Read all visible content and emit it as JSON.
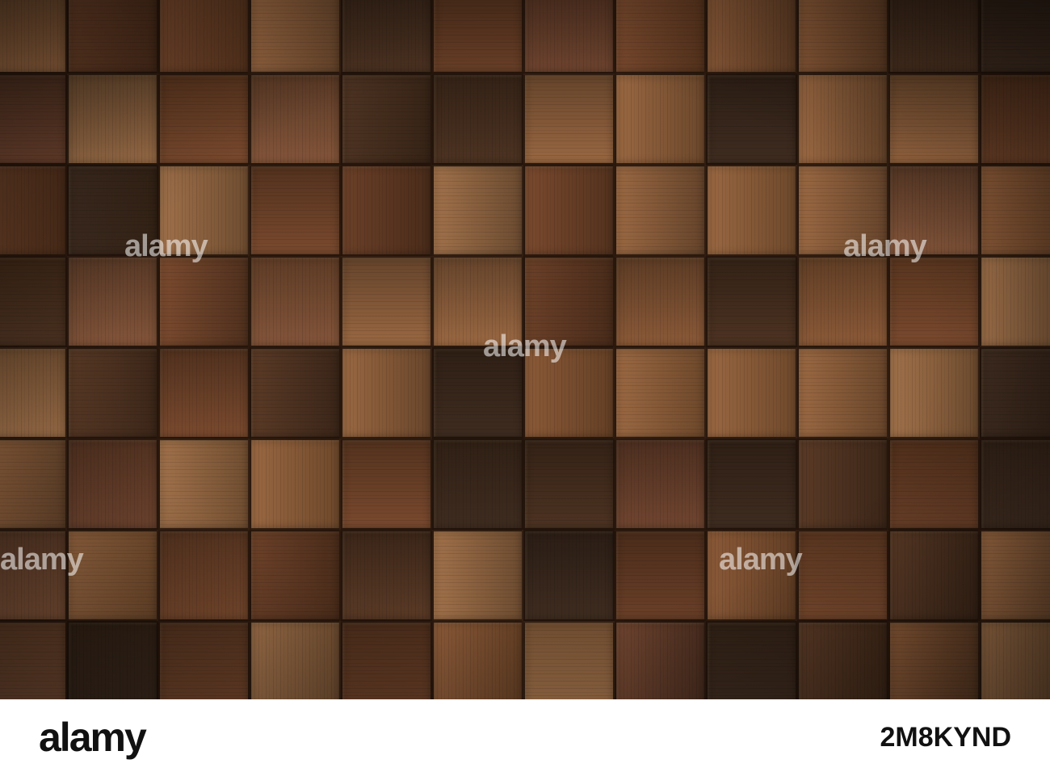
{
  "image": {
    "subject": "wood-tile-mosaic",
    "palette": [
      "#7a4a2e",
      "#8b5a38",
      "#6b4028",
      "#5a3a26",
      "#9a6842",
      "#704530",
      "#4d3322",
      "#a0714a",
      "#83553a",
      "#3f2c20"
    ]
  },
  "watermarks": {
    "text": "alamy",
    "icon": "alamy-a-icon"
  },
  "footer": {
    "logo": "alamy",
    "image_id": "2M8KYND"
  }
}
